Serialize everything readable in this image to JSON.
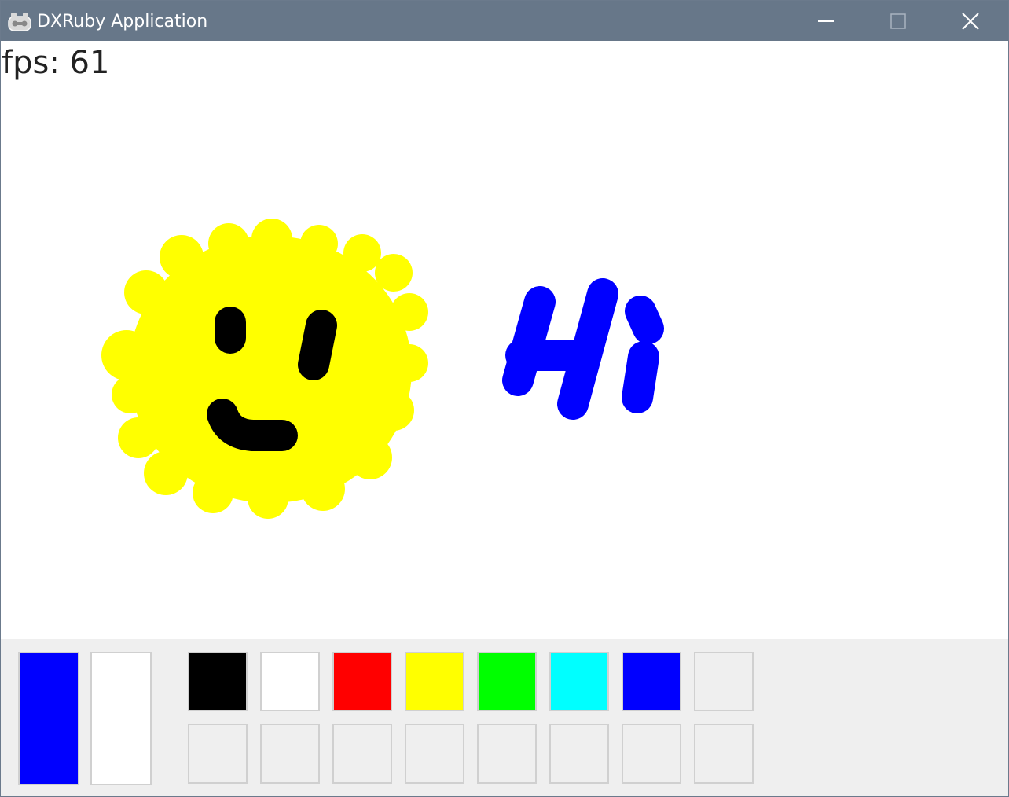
{
  "window": {
    "title": "DXRuby Application",
    "icon": "gamepad-icon",
    "controls": [
      "minimize-icon",
      "maximize-icon",
      "close-icon"
    ]
  },
  "canvas": {
    "fps_label": "fps: 61",
    "background": "#ffffff",
    "strokes": {
      "face_fill": "#ffff00",
      "face_features": "#000000",
      "text": "#0000ff"
    }
  },
  "palette": {
    "foreground_color": "#0000ff",
    "background_color": "#ffffff",
    "row1": [
      "#000000",
      "#ffffff",
      "#ff0000",
      "#ffff00",
      "#00ff00",
      "#00ffff",
      "#0000ff",
      "#efefef"
    ],
    "row2": [
      "#efefef",
      "#efefef",
      "#efefef",
      "#efefef",
      "#efefef",
      "#efefef",
      "#efefef",
      "#efefef"
    ]
  }
}
